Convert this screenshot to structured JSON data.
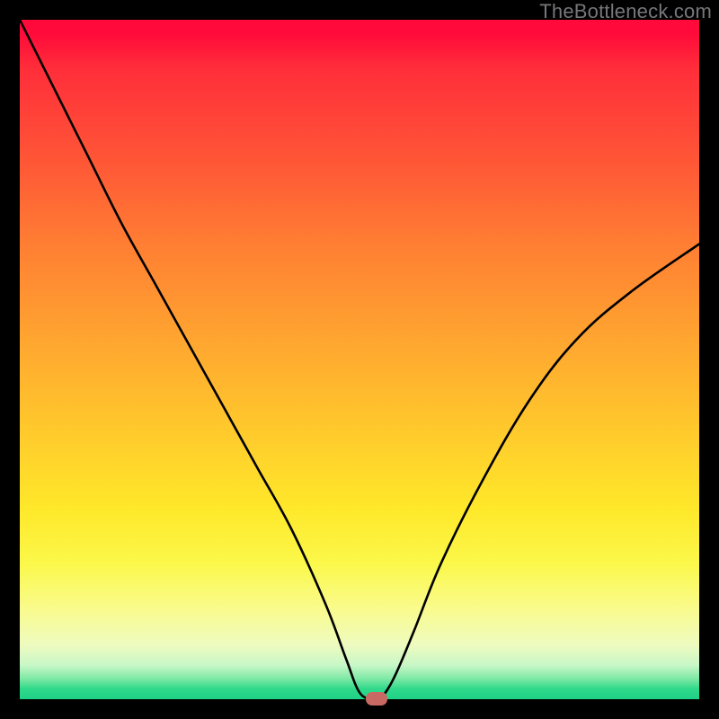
{
  "watermark": "TheBottleneck.com",
  "chart_data": {
    "type": "line",
    "title": "",
    "xlabel": "",
    "ylabel": "",
    "xlim": [
      0,
      100
    ],
    "ylim": [
      0,
      100
    ],
    "grid": false,
    "series": [
      {
        "name": "curve",
        "x": [
          0,
          5,
          10,
          15,
          20,
          25,
          30,
          35,
          40,
          45,
          48,
          50,
          52,
          53,
          55,
          58,
          62,
          68,
          75,
          82,
          90,
          100
        ],
        "values": [
          100,
          90,
          80,
          70,
          61,
          52,
          43,
          34,
          25,
          14,
          6,
          1,
          0,
          0,
          3,
          10,
          20,
          32,
          44,
          53,
          60,
          67
        ]
      }
    ],
    "marker": {
      "x": 52.5,
      "y": 0,
      "color": "#c86a63"
    },
    "gradient_colors": {
      "top": "#ff0a3a",
      "mid_high": "#ffa530",
      "mid": "#ffe82a",
      "mid_low": "#f9fb90",
      "bottom": "#1fd186"
    }
  }
}
